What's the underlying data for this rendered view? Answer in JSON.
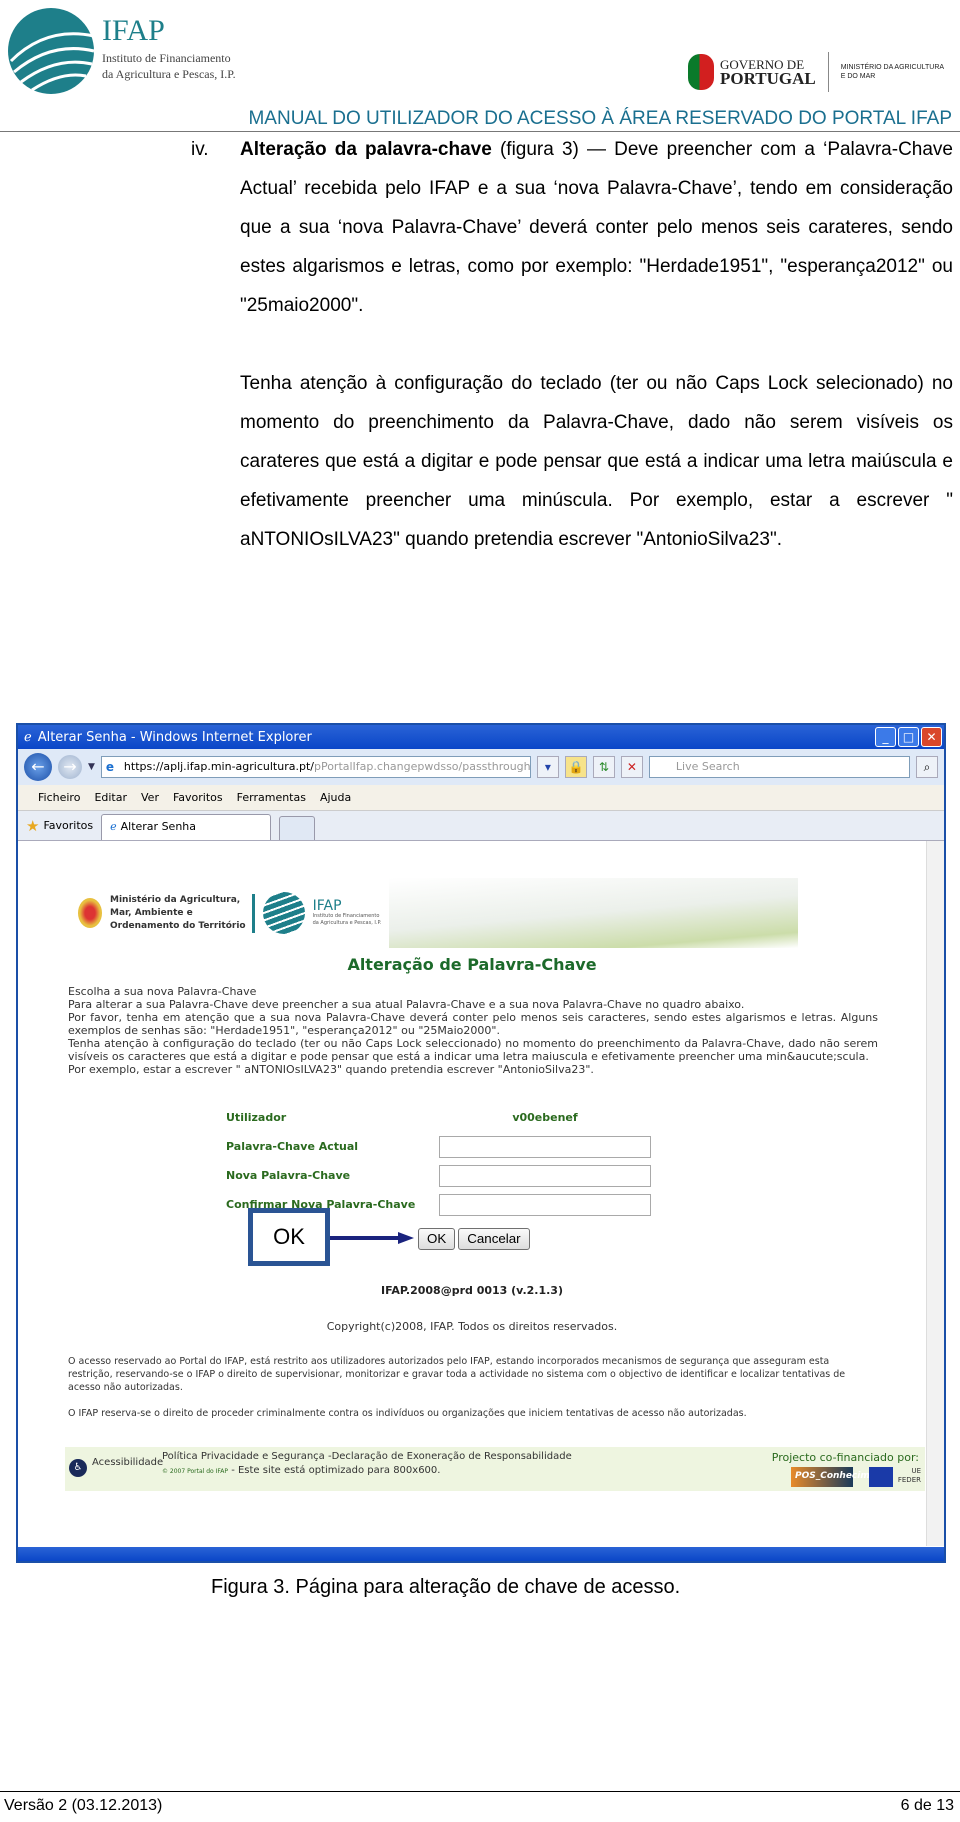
{
  "header": {
    "logo_name": "IFAP",
    "logo_subtitle_1": "Instituto de Financiamento",
    "logo_subtitle_2": "da Agricultura e Pescas, I.P.",
    "gov_line1": "GOVERNO DE",
    "gov_line2": "PORTUGAL",
    "ministry_1": "MINISTÉRIO DA AGRICULTURA",
    "ministry_2": "E DO MAR",
    "manual_title": "MANUAL DO UTILIZADOR DO ACESSO À ÁREA RESERVADO DO PORTAL IFAP"
  },
  "body": {
    "item_number": "iv.",
    "item_title": "Alteração da palavra-chave",
    "para1_rest": " (figura 3) — Deve preencher com a ‘Palavra-Chave Actual’ recebida pelo IFAP e a sua ‘nova Palavra-Chave’, tendo em consideração que a sua ‘nova Palavra-Chave’ deverá conter pelo menos seis carateres, sendo estes algarismos e letras, como por exemplo: \"Herdade1951\", \"esperança2012\" ou \"25maio2000\".",
    "para2": "Tenha atenção à configuração do teclado (ter ou não Caps Lock selecionado) no momento do preenchimento da Palavra-Chave, dado não serem visíveis os carateres que está a digitar e pode pensar que está a indicar uma letra maiúscula e efetivamente preencher uma minúscula. Por exemplo, estar a escrever \" aNTONIOsILVA23\" quando pretendia escrever \"AntonioSilva23\"."
  },
  "browser": {
    "window_title": "Alterar Senha - Windows Internet Explorer",
    "url_host": "https://aplj.ifap.min-agricultura.pt/",
    "url_path": "pPortalIfap.changepwdsso/passthroughtser",
    "search_placeholder": "Live Search",
    "menu": [
      "Ficheiro",
      "Editar",
      "Ver",
      "Favoritos",
      "Ferramentas",
      "Ajuda"
    ],
    "favorites_label": "Favoritos",
    "tab_label": "Alterar Senha"
  },
  "site": {
    "ministry_1": "Ministério da Agricultura,",
    "ministry_2": "Mar, Ambiente e",
    "ministry_3": "Ordenamento do Território",
    "ifap": "IFAP",
    "ifap_sub1": "Instituto de Financiamento",
    "ifap_sub2": "da Agricultura e Pescas, I.P.",
    "page_title": "Alteração de Palavra-Chave",
    "intro": [
      "Escolha a sua nova Palavra-Chave",
      "Para alterar a sua Palavra-Chave deve preencher a sua atual Palavra-Chave e a sua nova Palavra-Chave no quadro abaixo.",
      "Por favor, tenha em atenção que a sua nova Palavra-Chave deverá conter pelo menos seis caracteres, sendo estes algarismos e letras. Alguns exemplos de senhas são: \"Herdade1951\", \"esperança2012\" ou \"25Maio2000\".",
      "Tenha atenção à configuração do teclado (ter ou não Caps Lock seleccionado) no momento do preenchimento da Palavra-Chave, dado não serem visíveis os caracteres que está a digitar e pode pensar que está a indicar uma letra maiuscula e efetivamente preencher uma min&aucute;scula.",
      "Por exemplo, estar a escrever \" aNTONIOsILVA23\" quando pretendia escrever \"AntonioSilva23\"."
    ],
    "form": {
      "user_label": "Utilizador",
      "user_value": "v00ebenef",
      "current_label": "Palavra-Chave Actual",
      "new_label": "Nova Palavra-Chave",
      "confirm_label": "Confirmar Nova Palavra-Chave",
      "current_value": "",
      "new_value": "",
      "confirm_value": ""
    },
    "ok_button": "OK",
    "cancel_button": "Cancelar",
    "callout": "OK",
    "version": "IFAP.2008@prd 0013 (v.2.1.3)",
    "copyright": "Copyright(c)2008, IFAP. Todos os direitos reservados.",
    "legal1": "O acesso reservado ao Portal do IFAP, está restrito aos utilizadores autorizados pelo IFAP, estando incorporados mecanismos de segurança que asseguram esta restrição, reservando-se o IFAP o direito de supervisionar, monitorizar e gravar toda a actividade no sistema com o objectivo de identificar e localizar tentativas de acesso não autorizadas.",
    "legal2": "O IFAP reserva-se o direito de proceder criminalmente contra os indivíduos ou organizações que iniciem tentativas de acesso não autorizadas.",
    "footer": {
      "accessibility": "Acessibilidade",
      "policy": "Política Privacidade e Segurança -Declaração de Exoneração de Responsabilidade",
      "small_copy": "© 2007 Portal do IFAP",
      "optimized": " - Este site está optimizado para 800x600.",
      "cofinanced": "Projecto co-financiado por:",
      "pos": "POS_Conhecimento",
      "ue1": "UE",
      "ue2": "FEDER"
    }
  },
  "caption": "Figura 3. Página para alteração de chave de acesso.",
  "page_footer": {
    "version": "Versão 2 (03.12.2013)",
    "page": "6 de 13"
  },
  "colors": {
    "accent": "#1e7f8a",
    "title_blue": "#1a6f8f",
    "form_green": "#2a6a1e",
    "callout_border": "#2a5494"
  }
}
